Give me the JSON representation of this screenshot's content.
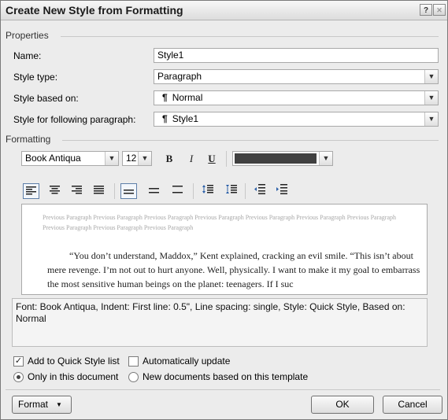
{
  "window": {
    "title": "Create New Style from Formatting",
    "help_label": "?",
    "close_label": "✕"
  },
  "properties": {
    "section_label": "Properties",
    "name": {
      "label": "Name:",
      "value": "Style1"
    },
    "style_type": {
      "label": "Style type:",
      "value": "Paragraph"
    },
    "style_based_on": {
      "label": "Style based on:",
      "glyph": "¶",
      "value": "Normal"
    },
    "style_following": {
      "label": "Style for following paragraph:",
      "glyph": "¶",
      "value": "Style1"
    }
  },
  "formatting": {
    "section_label": "Formatting",
    "font": "Book Antiqua",
    "size": "12",
    "bold_label": "B",
    "italic_label": "I",
    "underline_label": "U",
    "font_color": "#404040"
  },
  "preview": {
    "previous_paragraph": "Previous Paragraph Previous Paragraph Previous Paragraph Previous Paragraph Previous Paragraph Previous Paragraph Previous Paragraph Previous Paragraph Previous Paragraph Previous Paragraph",
    "sample_text": "“You don’t understand, Maddox,” Kent explained, cracking an evil smile. “This isn’t about mere revenge. I’m not out to hurt anyone. Well, physically. I want to make it my goal to embarrass the most sensitive human beings on the planet: teenagers. If I suc"
  },
  "description": "Font: Book Antiqua, Indent: First line:  0.5\", Line spacing:  single, Style: Quick Style, Based on: Normal",
  "options": {
    "add_quick_style": {
      "label": "Add to Quick Style list",
      "checked": true
    },
    "auto_update": {
      "label": "Automatically update",
      "checked": false
    },
    "only_this_doc": {
      "label": "Only in this document",
      "selected": true
    },
    "new_docs": {
      "label": "New documents based on this template",
      "selected": false
    }
  },
  "buttons": {
    "format": "Format",
    "ok": "OK",
    "cancel": "Cancel"
  }
}
